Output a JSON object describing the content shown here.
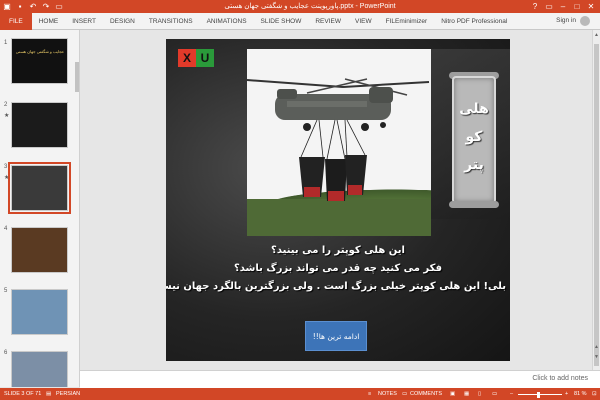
{
  "window": {
    "title": "پاورپوینت عجایب و شگفتی جهان هستی.pptx - PowerPoint",
    "minimize_icon": "minimize-icon",
    "restore_icon": "restore-icon",
    "close_icon": "close-icon",
    "help_icon": "help-icon"
  },
  "quick_access": [
    "save-icon",
    "undo-icon",
    "redo-icon",
    "present-icon"
  ],
  "ribbon": {
    "tabs": [
      "FILE",
      "HOME",
      "INSERT",
      "DESIGN",
      "TRANSITIONS",
      "ANIMATIONS",
      "SLIDE SHOW",
      "REVIEW",
      "VIEW",
      "FILEminimizer",
      "Nitro PDF Professional"
    ],
    "sign_in": "Sign in"
  },
  "thumbnails": [
    {
      "num": "1",
      "title": "عجایب و شگفتی جهان هستی"
    },
    {
      "num": "2",
      "title": ""
    },
    {
      "num": "3",
      "title": "",
      "selected": true
    },
    {
      "num": "4",
      "title": ""
    },
    {
      "num": "5",
      "title": ""
    },
    {
      "num": "6",
      "title": ""
    }
  ],
  "slide": {
    "logo_left": "X",
    "logo_right": "U",
    "banner_words": [
      "هلی",
      "کو",
      "پتر"
    ],
    "lines": [
      "این هلی کوپتر را می بینید؟",
      "فکر می کنید چه قدر می تواند بزرگ باشد؟",
      "بلی! این هلی کوپتر خیلی بزرگ است . ولی بزرگترین بالگرد جهان نیست"
    ],
    "continue_button": "ادامه ترین ها!!"
  },
  "notes": {
    "placeholder": "Click to add notes"
  },
  "status": {
    "slide_info": "SLIDE 3 OF 71",
    "language": "PERSIAN",
    "notes_label": "NOTES",
    "comments_label": "COMMENTS",
    "zoom": "81 %"
  },
  "colors": {
    "accent": "#d24726",
    "button": "#3d74b8"
  }
}
